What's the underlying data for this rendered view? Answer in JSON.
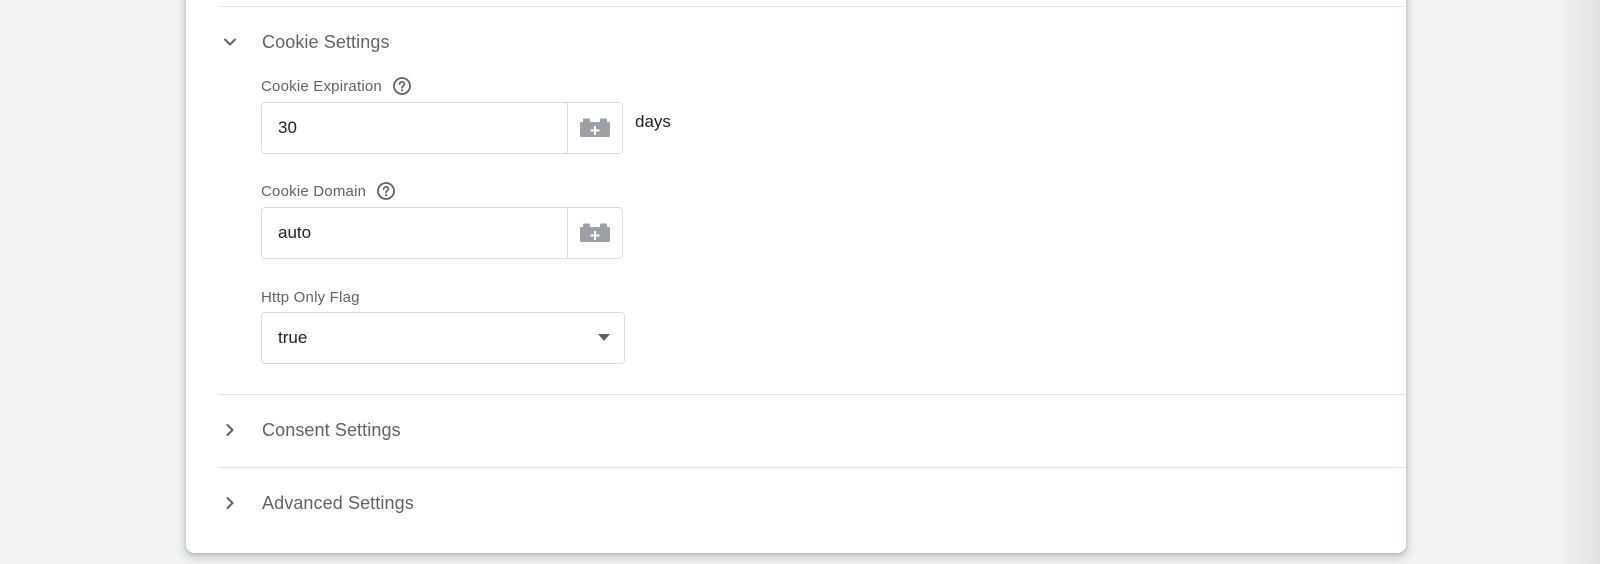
{
  "sections": {
    "cookie": {
      "title": "Cookie Settings",
      "expanded": true,
      "chevron_icon": "chevron-down-icon"
    },
    "consent": {
      "title": "Consent Settings",
      "expanded": false,
      "chevron_icon": "chevron-right-icon"
    },
    "advanced": {
      "title": "Advanced Settings",
      "expanded": false,
      "chevron_icon": "chevron-right-icon"
    }
  },
  "fields": {
    "cookie_expiration": {
      "label": "Cookie Expiration",
      "value": "30",
      "unit": "days",
      "help_icon": "help-circle-icon",
      "variable_icon": "variable-brick-icon"
    },
    "cookie_domain": {
      "label": "Cookie Domain",
      "value": "auto",
      "help_icon": "help-circle-icon",
      "variable_icon": "variable-brick-icon"
    },
    "http_only_flag": {
      "label": "Http Only Flag",
      "selected": "true",
      "dropdown_icon": "caret-down-icon"
    }
  },
  "colors": {
    "background": "#f1f3f4",
    "panel": "#ffffff",
    "header_text": "#5f6368",
    "value_text": "#202124",
    "border": "#dadce0",
    "icon": "#9aa0a6"
  }
}
